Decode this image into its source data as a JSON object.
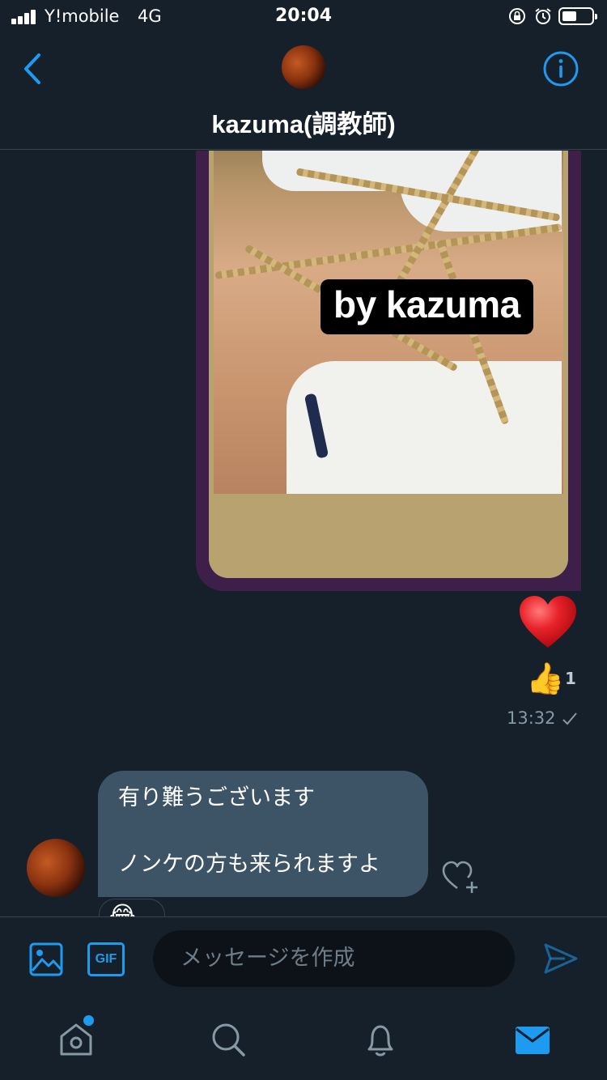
{
  "status_bar": {
    "carrier": "Y!mobile",
    "network": "4G",
    "time": "20:04"
  },
  "header": {
    "title": "kazuma(調教師)",
    "back_icon": "chevron-left-icon",
    "info_icon": "info-icon"
  },
  "messages": {
    "media": {
      "watermark": "by kazuma"
    },
    "sent_reactions": {
      "heart": "❤️",
      "thumb": "👍",
      "thumb_count": "1"
    },
    "sent_time": "13:32",
    "received": {
      "line1": "有り難うございます",
      "line2": "ノンケの方も来られますよ",
      "reaction": "😂"
    }
  },
  "composer": {
    "gif_label": "GIF",
    "placeholder": "メッセージを作成"
  },
  "tabbar": {
    "items": [
      "home-icon",
      "search-icon",
      "notifications-icon",
      "messages-icon"
    ]
  },
  "colors": {
    "background": "#15202b",
    "accent": "#1d9bf0",
    "received_bubble": "#3d5466",
    "divider": "#38444d"
  }
}
